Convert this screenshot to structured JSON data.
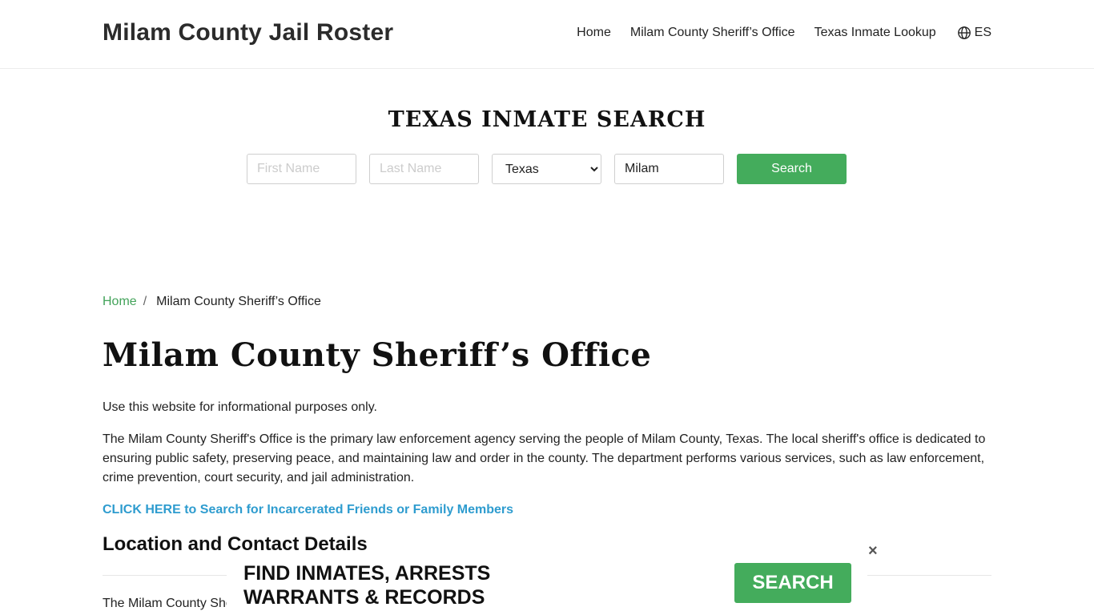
{
  "header": {
    "site_title": "Milam County Jail Roster",
    "nav": [
      "Home",
      "Milam County Sheriff’s Office",
      "Texas Inmate Lookup"
    ],
    "lang": "ES"
  },
  "search": {
    "title": "TEXAS INMATE SEARCH",
    "first_placeholder": "First Name",
    "last_placeholder": "Last Name",
    "state_selected": "Texas",
    "county_value": "Milam",
    "button": "Search"
  },
  "breadcrumb": {
    "home": "Home",
    "separator": "/",
    "current": "Milam County Sheriff’s Office"
  },
  "main": {
    "title": "Milam County Sheriff’s Office",
    "p1": "Use this website for informational purposes only.",
    "p2": "The Milam County Sheriff's Office is the primary law enforcement agency serving the people of Milam County, Texas. The local sheriff's office is dedicated to ensuring public safety, preserving peace, and maintaining law and order in the county. The department performs various services, such as law enforcement, crime prevention, court security, and jail administration.",
    "cta": "CLICK HERE to Search for Incarcerated Friends or Family Members",
    "section_heading": "Location and Contact Details",
    "p3": "The Milam County She"
  },
  "banner": {
    "line1": "FIND INMATES, ARRESTS",
    "line2": "WARRANTS & RECORDS",
    "button": "SEARCH",
    "close": "×"
  },
  "colors": {
    "accent_green": "#44ac5c",
    "link_blue": "#2e9ccf"
  }
}
